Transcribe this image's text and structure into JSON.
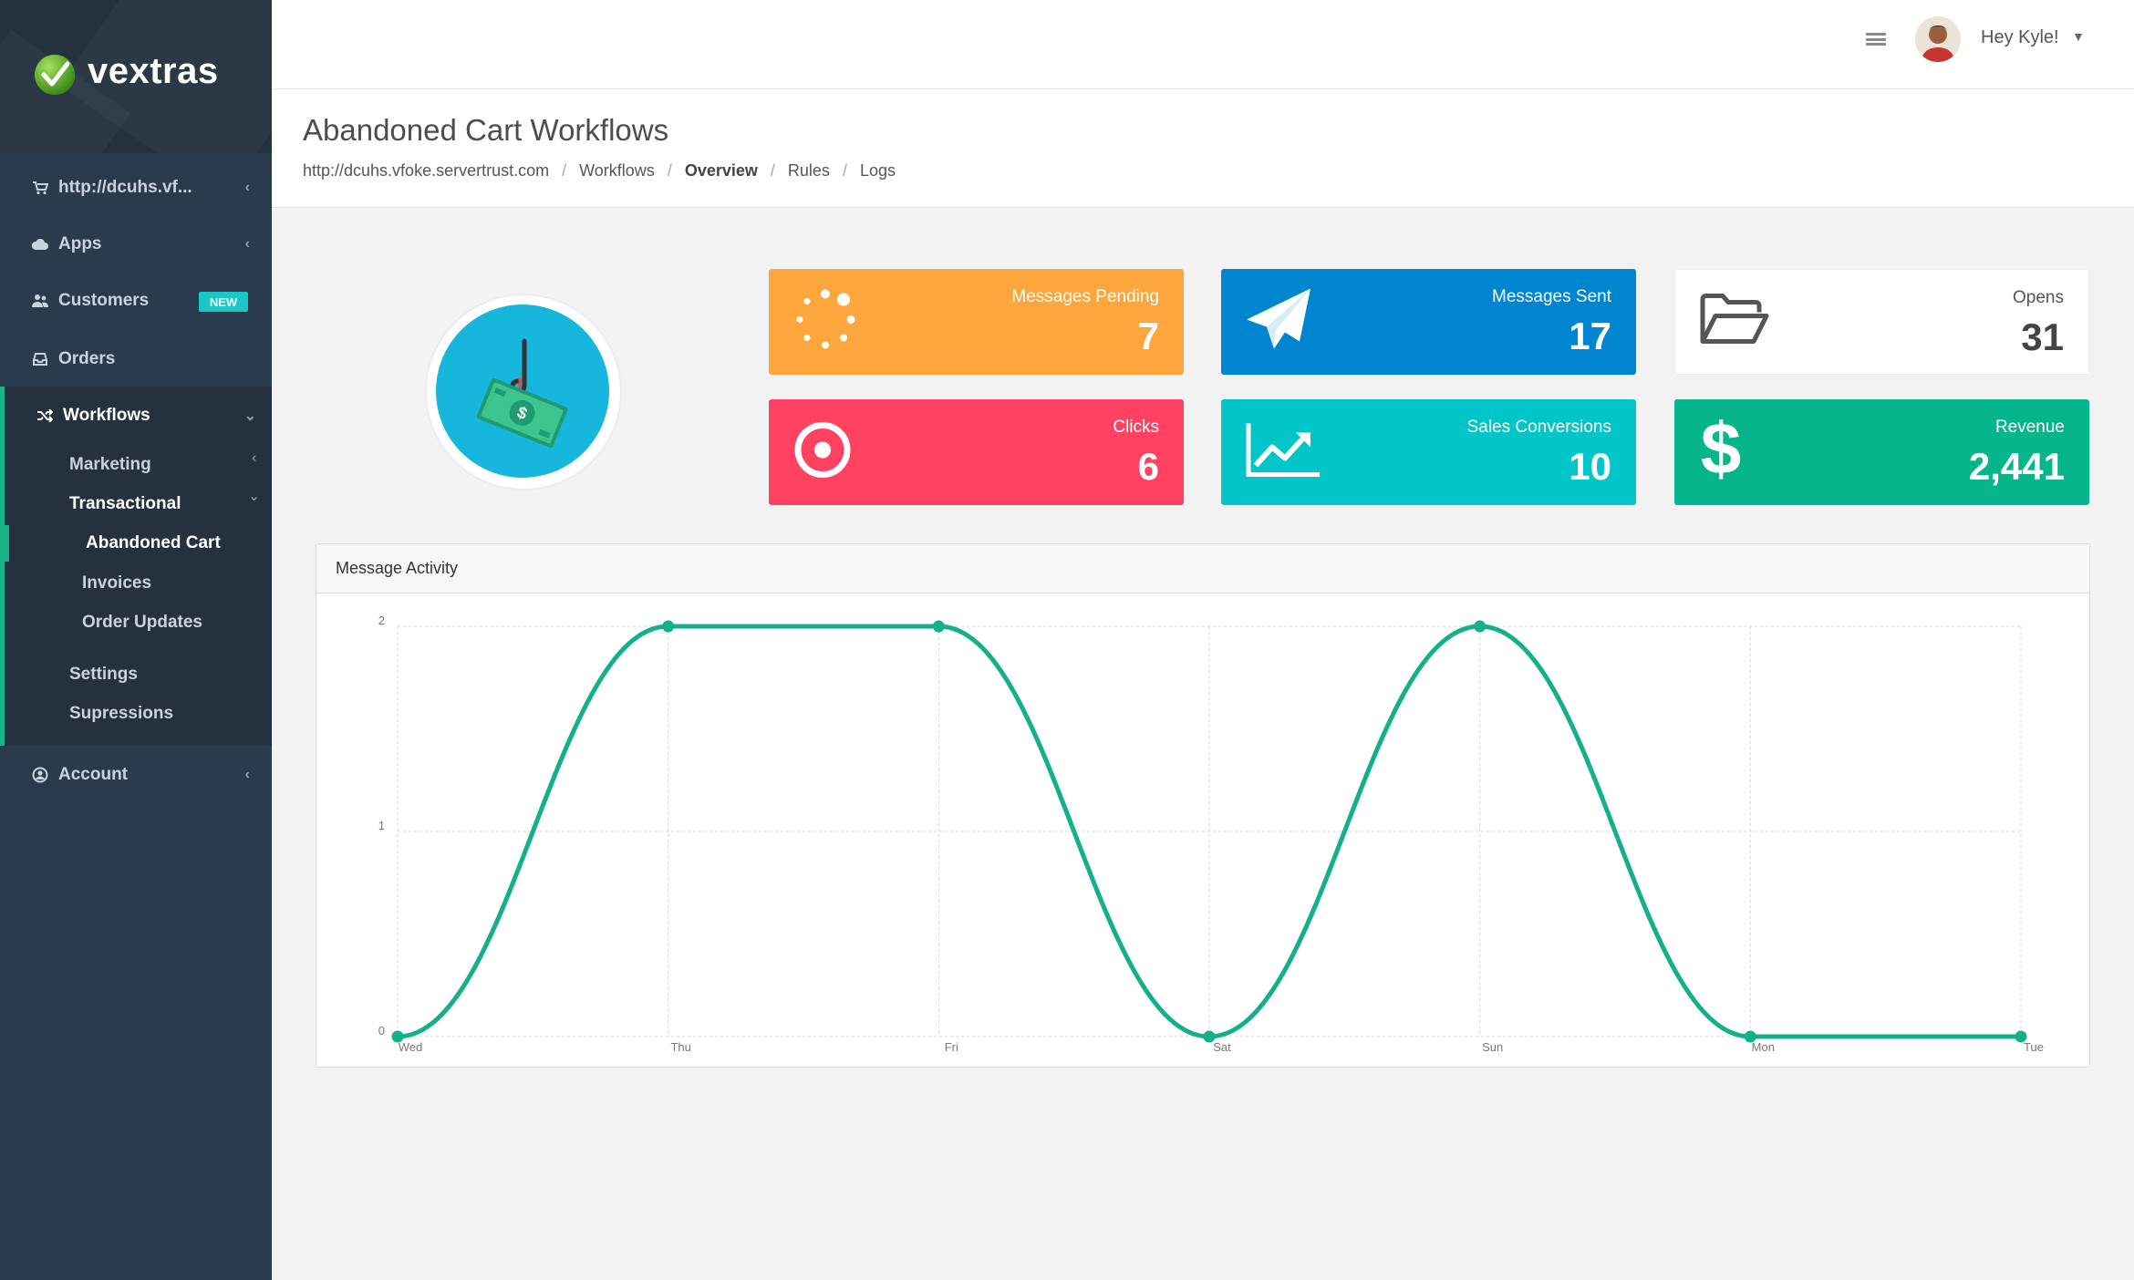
{
  "brand": {
    "name": "vextras"
  },
  "sidebar": {
    "items": [
      {
        "label": "http://dcuhs.vf...",
        "icon": "cart-icon"
      },
      {
        "label": "Apps",
        "icon": "cloud-icon"
      },
      {
        "label": "Customers",
        "icon": "users-icon",
        "badge": "NEW"
      },
      {
        "label": "Orders",
        "icon": "inbox-icon"
      },
      {
        "label": "Workflows",
        "icon": "shuffle-icon"
      },
      {
        "label": "Account",
        "icon": "user-circle-icon"
      }
    ],
    "workflows_sub": {
      "marketing": "Marketing",
      "transactional": "Transactional",
      "abandoned_cart": "Abandoned Cart",
      "invoices": "Invoices",
      "order_updates": "Order Updates",
      "settings": "Settings",
      "supressions": "Supressions"
    }
  },
  "topbar": {
    "greeting": "Hey Kyle!"
  },
  "page": {
    "title": "Abandoned Cart Workflows",
    "breadcrumb": [
      "http://dcuhs.vfoke.servertrust.com",
      "Workflows",
      "Overview",
      "Rules",
      "Logs"
    ]
  },
  "stats": {
    "pending": {
      "label": "Messages Pending",
      "value": "7",
      "color": "#fea63e",
      "icon": "spinner-icon"
    },
    "sent": {
      "label": "Messages Sent",
      "value": "17",
      "color": "#0085d0",
      "icon": "paper-plane-icon"
    },
    "opens": {
      "label": "Opens",
      "value": "31",
      "color": "#ffffff",
      "icon": "folder-open-icon"
    },
    "clicks": {
      "label": "Clicks",
      "value": "6",
      "color": "#ff4262",
      "icon": "target-icon"
    },
    "conversions": {
      "label": "Sales Conversions",
      "value": "10",
      "color": "#01c5c9",
      "icon": "line-chart-icon"
    },
    "revenue": {
      "label": "Revenue",
      "value": "2,441",
      "color": "#07b58c",
      "icon": "dollar-icon"
    }
  },
  "colors": {
    "accent": "#19b38a",
    "sidebar": "#2b3b4e",
    "chart_line": "#14b08b"
  },
  "chart": {
    "title": "Message Activity"
  },
  "chart_data": {
    "type": "line",
    "title": "Message Activity",
    "xlabel": "",
    "ylabel": "",
    "categories": [
      "Wed",
      "Thu",
      "Fri",
      "Sat",
      "Sun",
      "Mon",
      "Tue"
    ],
    "series": [
      {
        "values": [
          0,
          2,
          2,
          0,
          2,
          0,
          0
        ]
      }
    ],
    "ylim": [
      0,
      2
    ],
    "yticks": [
      0,
      1,
      2
    ],
    "grid": true,
    "smooth": true
  }
}
